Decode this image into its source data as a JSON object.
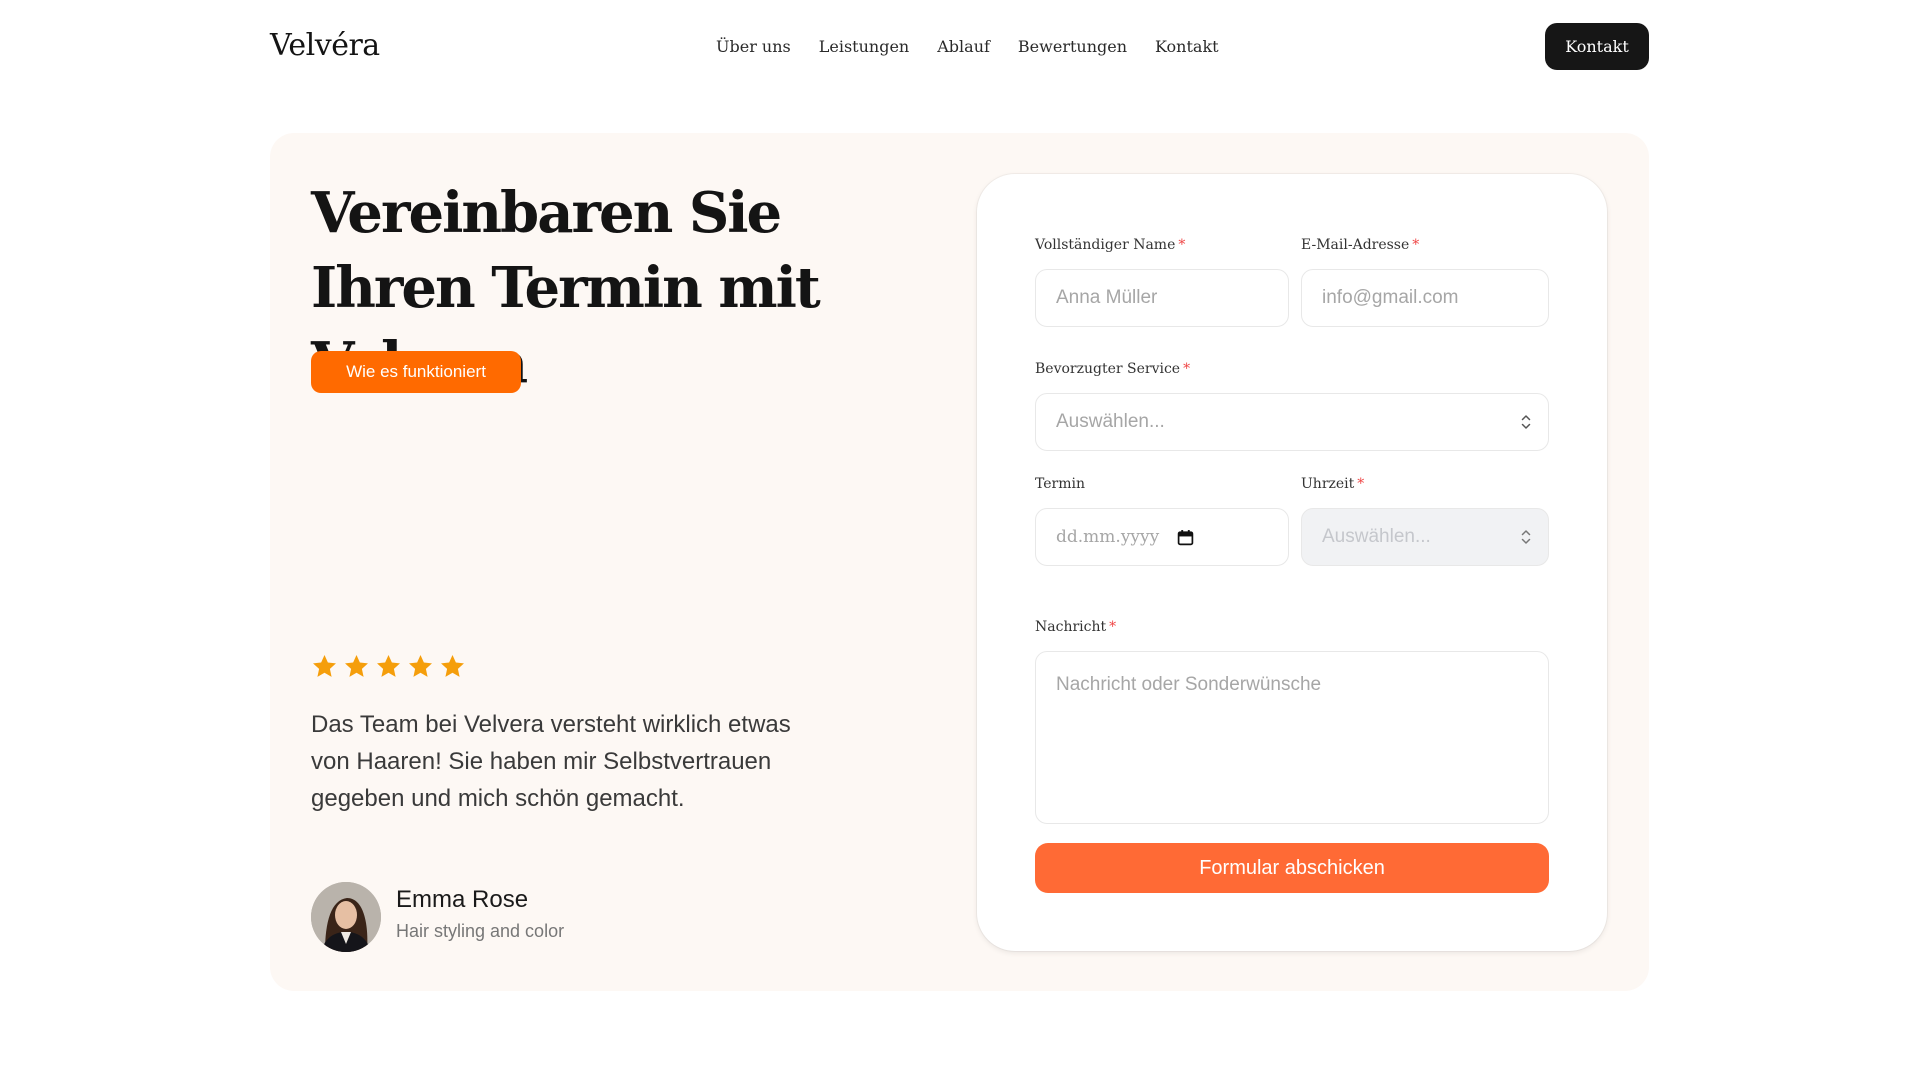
{
  "header": {
    "logo": "Velvéra",
    "nav": [
      "Über uns",
      "Leistungen",
      "Ablauf",
      "Bewertungen",
      "Kontakt"
    ],
    "cta_label": "Kontakt"
  },
  "hero": {
    "headline": "Vereinbaren Sie Ihren Termin mit Velvera",
    "how_button_label": "Wie es funktioniert"
  },
  "testimonial": {
    "rating": 5,
    "star_color": "#f59e0b",
    "quote": "Das Team bei Velvera versteht wirklich etwas von Haaren! Sie haben mir Selbstvertrauen gegeben und mich schön gemacht.",
    "name": "Emma Rose",
    "role": "Hair styling and color"
  },
  "form": {
    "name_label": "Vollständiger Name",
    "name_placeholder": "Anna Müller",
    "email_label": "E-Mail-Adresse",
    "email_placeholder": "info@gmail.com",
    "service_label": "Bevorzugter Service",
    "service_placeholder": "Auswählen...",
    "date_label": "Termin",
    "date_placeholder": "dd.mm.yyyy",
    "time_label": "Uhrzeit",
    "time_placeholder": "Auswählen...",
    "message_label": "Nachricht",
    "message_placeholder": "Nachricht oder Sonderwünsche",
    "required_mark": "*",
    "submit_label": "Formular abschicken"
  },
  "colors": {
    "accent": "#ff6a00",
    "submit": "#ff6a35",
    "dark": "#161616",
    "panel": "#fdf8f4",
    "required": "#ef4444"
  }
}
